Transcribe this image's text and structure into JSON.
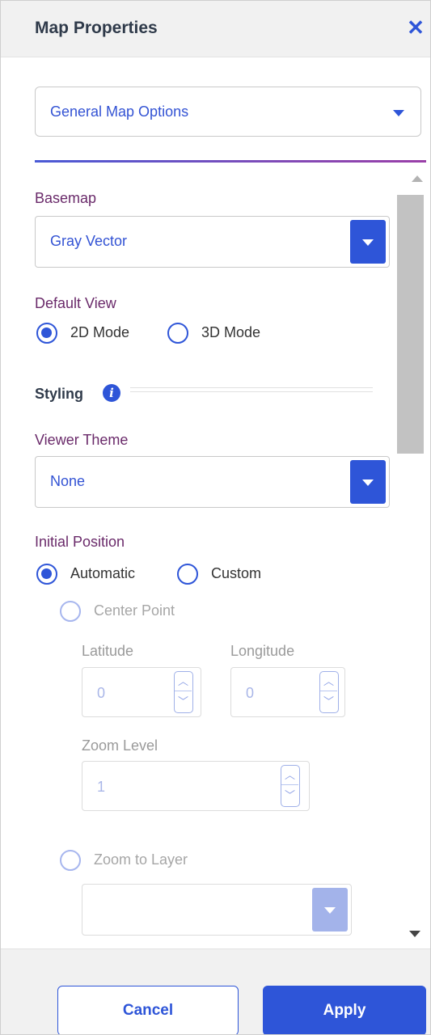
{
  "header": {
    "title": "Map Properties",
    "close_icon": "close-icon"
  },
  "section_select": {
    "value": "General Map Options",
    "icon": "chevron-down-icon"
  },
  "basemap": {
    "label": "Basemap",
    "value": "Gray Vector"
  },
  "default_view": {
    "label": "Default View",
    "options": [
      {
        "label": "2D Mode",
        "selected": true
      },
      {
        "label": "3D Mode",
        "selected": false
      }
    ]
  },
  "styling": {
    "heading": "Styling",
    "info_icon": "info-icon"
  },
  "viewer_theme": {
    "label": "Viewer Theme",
    "value": "None"
  },
  "initial_position": {
    "label": "Initial Position",
    "options": [
      {
        "label": "Automatic",
        "selected": true
      },
      {
        "label": "Custom",
        "selected": false
      }
    ],
    "center_point": {
      "label": "Center Point",
      "latitude_label": "Latitude",
      "latitude_value": "0",
      "longitude_label": "Longitude",
      "longitude_value": "0",
      "zoom_label": "Zoom Level",
      "zoom_value": "1"
    },
    "zoom_to_layer": {
      "label": "Zoom to Layer",
      "value": ""
    }
  },
  "footer": {
    "cancel_label": "Cancel",
    "apply_label": "Apply"
  },
  "colors": {
    "accent": "#2e55d8",
    "label_purple": "#6a2a6a",
    "disabled_accent": "#a3b3ea"
  }
}
